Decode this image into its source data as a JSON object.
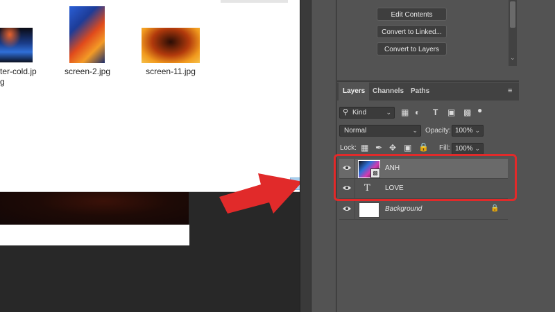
{
  "explorer": {
    "files": [
      {
        "name": "ter-cold.jp\ng",
        "thumb": "cold-fire-thumbnail"
      },
      {
        "name": "screen-2.jpg",
        "thumb": "blue-red-fire-thumbnail"
      },
      {
        "name": "screen-11.jpg",
        "thumb": "fire-cloud-thumbnail"
      }
    ]
  },
  "properties": {
    "buttons": [
      "Edit Contents",
      "Convert to Linked...",
      "Convert to Layers"
    ]
  },
  "layers_panel": {
    "tabs": [
      "Layers",
      "Channels",
      "Paths"
    ],
    "active_tab": "Layers",
    "filter_kind": "Kind",
    "blend_mode": "Normal",
    "opacity_label": "Opacity:",
    "opacity_value": "100%",
    "lock_label": "Lock:",
    "fill_label": "Fill:",
    "fill_value": "100%",
    "layers": [
      {
        "name": "ANH",
        "type": "smart-object",
        "selected": true
      },
      {
        "name": "LOVE",
        "type": "text",
        "selected": false
      },
      {
        "name": "Background",
        "type": "background",
        "locked": true,
        "selected": false
      }
    ],
    "type_glyph": "T"
  },
  "colors": {
    "annotation_red": "#e12a2a",
    "panel_bg": "#535353",
    "selected_row": "#6a6a6a"
  }
}
